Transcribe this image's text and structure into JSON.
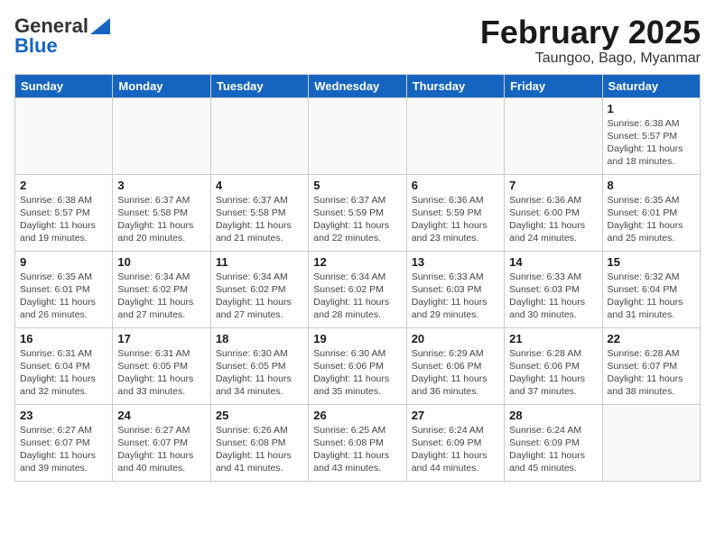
{
  "logo": {
    "general": "General",
    "blue": "Blue"
  },
  "title": {
    "month": "February 2025",
    "location": "Taungoo, Bago, Myanmar"
  },
  "headers": [
    "Sunday",
    "Monday",
    "Tuesday",
    "Wednesday",
    "Thursday",
    "Friday",
    "Saturday"
  ],
  "weeks": [
    [
      {
        "day": "",
        "info": ""
      },
      {
        "day": "",
        "info": ""
      },
      {
        "day": "",
        "info": ""
      },
      {
        "day": "",
        "info": ""
      },
      {
        "day": "",
        "info": ""
      },
      {
        "day": "",
        "info": ""
      },
      {
        "day": "1",
        "info": "Sunrise: 6:38 AM\nSunset: 5:57 PM\nDaylight: 11 hours\nand 18 minutes."
      }
    ],
    [
      {
        "day": "2",
        "info": "Sunrise: 6:38 AM\nSunset: 5:57 PM\nDaylight: 11 hours\nand 19 minutes."
      },
      {
        "day": "3",
        "info": "Sunrise: 6:37 AM\nSunset: 5:58 PM\nDaylight: 11 hours\nand 20 minutes."
      },
      {
        "day": "4",
        "info": "Sunrise: 6:37 AM\nSunset: 5:58 PM\nDaylight: 11 hours\nand 21 minutes."
      },
      {
        "day": "5",
        "info": "Sunrise: 6:37 AM\nSunset: 5:59 PM\nDaylight: 11 hours\nand 22 minutes."
      },
      {
        "day": "6",
        "info": "Sunrise: 6:36 AM\nSunset: 5:59 PM\nDaylight: 11 hours\nand 23 minutes."
      },
      {
        "day": "7",
        "info": "Sunrise: 6:36 AM\nSunset: 6:00 PM\nDaylight: 11 hours\nand 24 minutes."
      },
      {
        "day": "8",
        "info": "Sunrise: 6:35 AM\nSunset: 6:01 PM\nDaylight: 11 hours\nand 25 minutes."
      }
    ],
    [
      {
        "day": "9",
        "info": "Sunrise: 6:35 AM\nSunset: 6:01 PM\nDaylight: 11 hours\nand 26 minutes."
      },
      {
        "day": "10",
        "info": "Sunrise: 6:34 AM\nSunset: 6:02 PM\nDaylight: 11 hours\nand 27 minutes."
      },
      {
        "day": "11",
        "info": "Sunrise: 6:34 AM\nSunset: 6:02 PM\nDaylight: 11 hours\nand 27 minutes."
      },
      {
        "day": "12",
        "info": "Sunrise: 6:34 AM\nSunset: 6:02 PM\nDaylight: 11 hours\nand 28 minutes."
      },
      {
        "day": "13",
        "info": "Sunrise: 6:33 AM\nSunset: 6:03 PM\nDaylight: 11 hours\nand 29 minutes."
      },
      {
        "day": "14",
        "info": "Sunrise: 6:33 AM\nSunset: 6:03 PM\nDaylight: 11 hours\nand 30 minutes."
      },
      {
        "day": "15",
        "info": "Sunrise: 6:32 AM\nSunset: 6:04 PM\nDaylight: 11 hours\nand 31 minutes."
      }
    ],
    [
      {
        "day": "16",
        "info": "Sunrise: 6:31 AM\nSunset: 6:04 PM\nDaylight: 11 hours\nand 32 minutes."
      },
      {
        "day": "17",
        "info": "Sunrise: 6:31 AM\nSunset: 6:05 PM\nDaylight: 11 hours\nand 33 minutes."
      },
      {
        "day": "18",
        "info": "Sunrise: 6:30 AM\nSunset: 6:05 PM\nDaylight: 11 hours\nand 34 minutes."
      },
      {
        "day": "19",
        "info": "Sunrise: 6:30 AM\nSunset: 6:06 PM\nDaylight: 11 hours\nand 35 minutes."
      },
      {
        "day": "20",
        "info": "Sunrise: 6:29 AM\nSunset: 6:06 PM\nDaylight: 11 hours\nand 36 minutes."
      },
      {
        "day": "21",
        "info": "Sunrise: 6:28 AM\nSunset: 6:06 PM\nDaylight: 11 hours\nand 37 minutes."
      },
      {
        "day": "22",
        "info": "Sunrise: 6:28 AM\nSunset: 6:07 PM\nDaylight: 11 hours\nand 38 minutes."
      }
    ],
    [
      {
        "day": "23",
        "info": "Sunrise: 6:27 AM\nSunset: 6:07 PM\nDaylight: 11 hours\nand 39 minutes."
      },
      {
        "day": "24",
        "info": "Sunrise: 6:27 AM\nSunset: 6:07 PM\nDaylight: 11 hours\nand 40 minutes."
      },
      {
        "day": "25",
        "info": "Sunrise: 6:26 AM\nSunset: 6:08 PM\nDaylight: 11 hours\nand 41 minutes."
      },
      {
        "day": "26",
        "info": "Sunrise: 6:25 AM\nSunset: 6:08 PM\nDaylight: 11 hours\nand 43 minutes."
      },
      {
        "day": "27",
        "info": "Sunrise: 6:24 AM\nSunset: 6:09 PM\nDaylight: 11 hours\nand 44 minutes."
      },
      {
        "day": "28",
        "info": "Sunrise: 6:24 AM\nSunset: 6:09 PM\nDaylight: 11 hours\nand 45 minutes."
      },
      {
        "day": "",
        "info": ""
      }
    ]
  ]
}
